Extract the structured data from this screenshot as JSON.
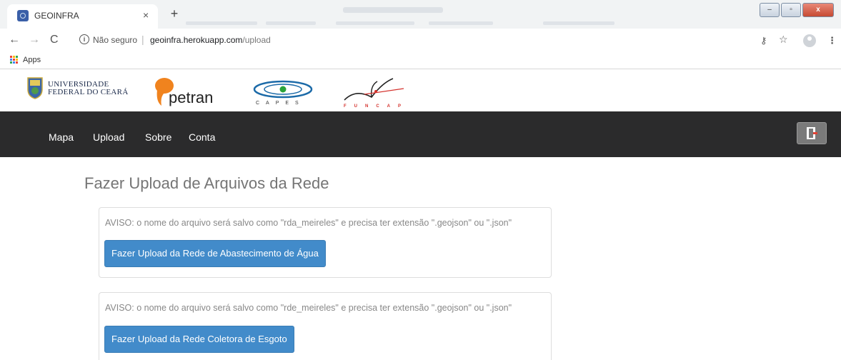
{
  "browser": {
    "tab_title": "GEOINFRA",
    "tab_close": "×",
    "new_tab": "+",
    "security_label": "Não seguro",
    "url_host": "geoinfra.herokuapp.com",
    "url_path": "/upload",
    "bookmark_apps": "Apps",
    "window_minimize": "–",
    "window_maximize": "▫",
    "window_close": "x"
  },
  "logos": {
    "ufc_line1": "UNIVERSIDADE",
    "ufc_line2": "FEDERAL DO CEARÁ",
    "petran": "petran",
    "capes": "CAPES",
    "funcap": "FUNCAP"
  },
  "navbar": {
    "items": [
      {
        "label": "Mapa"
      },
      {
        "label": "Upload"
      },
      {
        "label": "Sobre"
      },
      {
        "label": "Conta"
      }
    ],
    "logout_icon": "door-exit-icon"
  },
  "page": {
    "title": "Fazer Upload de Arquivos da Rede",
    "panels": [
      {
        "warning": "AVISO: o nome do arquivo será salvo como \"rda_meireles\" e precisa ter extensão \".geojson\" ou \".json\"",
        "button": "Fazer Upload da Rede de Abastecimento de Água"
      },
      {
        "warning": "AVISO: o nome do arquivo será salvo como \"rde_meireles\" e precisa ter extensão \".geojson\" ou \".json\"",
        "button": "Fazer Upload da Rede Coletora de Esgoto"
      }
    ]
  },
  "colors": {
    "navbar_bg": "#2b2b2c",
    "button_bg": "#428bca",
    "title_text": "#757575",
    "warning_text": "#888888"
  }
}
